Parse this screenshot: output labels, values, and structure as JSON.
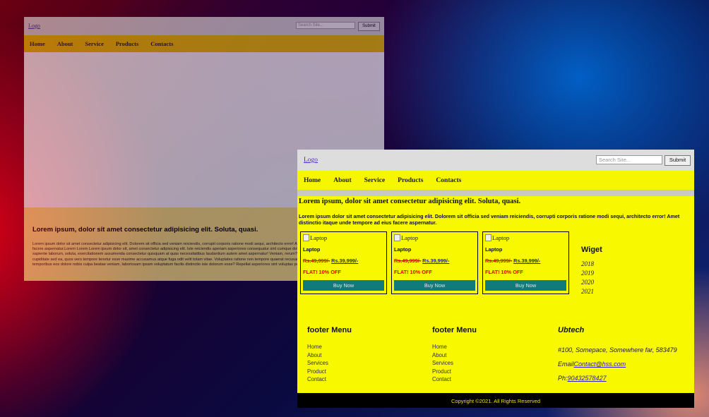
{
  "site": {
    "logo_alt": "Logo",
    "search_placeholder": "Search Site...",
    "submit_label": "Submit",
    "nav": [
      "Home",
      "About",
      "Service",
      "Products",
      "Contacts"
    ]
  },
  "back": {
    "headline": "Lorem ipsum, dolor sit amet consectetur adipisicing elit. Soluta, quasi.",
    "body": "Lorem ipsum dolor sit amet consectetur adipisicing elit. Dolorem sit officia sed veniam reiciendis, corrupti corporis ratione modi sequi, architecto error! Amet distinctio itaque unde tempore ad eius facere aspernatur.Lorem Lorem Lorem ipsum dolor sit, amet consectetur adipisicing elit. Iste reiciendis aperiam asperiores consequatur sint cumque dolorem maiores sequi, corporis reprehenderit sapiente laborum, soluta, exercitationem assumenda consectetur quisquam at quas necessitatibus laudantium autem amet aspernatur! Veniam, rerum? Id recusandae dolorem est molestias cupiditate sed ea, quos vero tempore tenetur esse maxime accusamus atque fuga odit velit totam vitae. Voluptates ratione non tempore quaerat recusandae officiis earum quas, commodi temporibus eos dolore nobis culpa beatae veniam, laboriosam ipsam voluptatum facilis distinctio iste dolorum esse? Repellat asperiores sint voluptas possimus, maiores pariatur perferendis."
  },
  "front": {
    "headline": "Lorem ipsum, dolor sit amet consectetur adipisicing elit. Soluta, quasi.",
    "intro": "Lorem ipsum dolor sit amet consectetur adipisicing elit. Dolorem sit officia sed veniam reiciendis, corrupti corporis ratione modi sequi, architecto error! Amet distinctio itaque unde tempore ad eius facere aspernatur.",
    "products": [
      {
        "img_alt": "Laptop",
        "name": "Laptop",
        "old_price": "Rs.49,999/-",
        "new_price": "Rs.39,999/-",
        "offer": "FLAT! 10% OFF",
        "button": "Buy Now"
      },
      {
        "img_alt": "Laptop",
        "name": "Laptop",
        "old_price": "Rs.49,999/-",
        "new_price": "Rs.39,999/-",
        "offer": "FLAT! 10% OFF",
        "button": "Buy Now"
      },
      {
        "img_alt": "Laptop",
        "name": "Laptop",
        "old_price": "Rs.49,999/-",
        "new_price": "Rs.39,999/-",
        "offer": "FLAT! 10% OFF",
        "button": "Buy Now"
      }
    ],
    "widget": {
      "title": "Wiget",
      "years": [
        "2018",
        "2019",
        "2020",
        "2021"
      ]
    },
    "footer": {
      "menu1": {
        "title": "footer Menu",
        "links": [
          "Home",
          "About",
          "Services",
          "Product",
          "Contact"
        ]
      },
      "menu2": {
        "title": "footer Menu",
        "links": [
          "Home",
          "About",
          "Services",
          "Product",
          "Contact"
        ]
      },
      "company": {
        "title": "Ubtech",
        "address": "#100, Somepace, Somewhere far, 583479",
        "email_label": "Email",
        "email": "Contact@hss.com",
        "phone_label": "Ph:",
        "phone": "90432578427"
      }
    },
    "copyright": "Copyright ©2021. All Rights Reserved"
  },
  "colors": {
    "nav_yellow": "#f6f600",
    "button_teal": "#117a7a",
    "price_red": "#e00000",
    "footer_black": "#000000"
  }
}
